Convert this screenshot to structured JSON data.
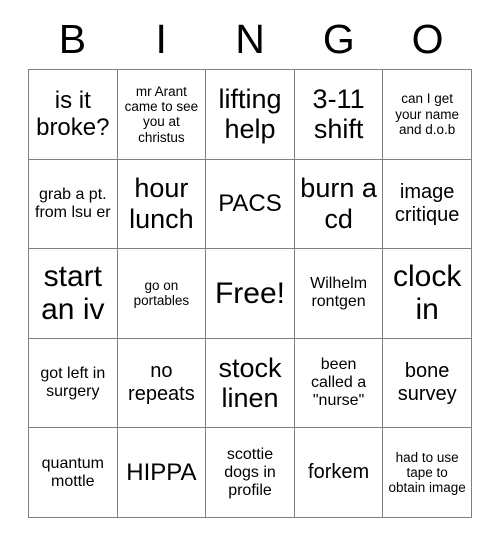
{
  "card": {
    "header_letters": [
      "B",
      "I",
      "N",
      "G",
      "O"
    ],
    "rows": [
      [
        {
          "text": "is it broke?",
          "size": "lg"
        },
        {
          "text": "mr Arant came to see you at christus",
          "size": "xs"
        },
        {
          "text": "lifting help",
          "size": "xl"
        },
        {
          "text": "3-11 shift",
          "size": "xl"
        },
        {
          "text": "can I get your name and d.o.b",
          "size": "xs"
        }
      ],
      [
        {
          "text": "grab a pt. from lsu er",
          "size": "sm"
        },
        {
          "text": "hour lunch",
          "size": "xl"
        },
        {
          "text": "PACS",
          "size": "lg"
        },
        {
          "text": "burn a cd",
          "size": "xl"
        },
        {
          "text": "image critique",
          "size": "md"
        }
      ],
      [
        {
          "text": "start an iv",
          "size": "xxl"
        },
        {
          "text": "go on portables",
          "size": "xs"
        },
        {
          "text": "Free!",
          "size": "xxl"
        },
        {
          "text": "Wilhelm rontgen",
          "size": "sm"
        },
        {
          "text": "clock in",
          "size": "xxl"
        }
      ],
      [
        {
          "text": "got left in surgery",
          "size": "sm"
        },
        {
          "text": "no repeats",
          "size": "md"
        },
        {
          "text": "stock linen",
          "size": "xl"
        },
        {
          "text": "been called a \"nurse\"",
          "size": "sm"
        },
        {
          "text": "bone survey",
          "size": "md"
        }
      ],
      [
        {
          "text": "quantum mottle",
          "size": "sm"
        },
        {
          "text": "HIPPA",
          "size": "lg"
        },
        {
          "text": "scottie dogs in profile",
          "size": "sm"
        },
        {
          "text": "forkem",
          "size": "md"
        },
        {
          "text": "had to use tape to obtain image",
          "size": "xs"
        }
      ]
    ],
    "free_space": {
      "label": "Free!",
      "row": 2,
      "column": 2
    },
    "colors": {
      "background": "#ffffff",
      "text": "#000000",
      "grid_line": "#808080"
    }
  }
}
